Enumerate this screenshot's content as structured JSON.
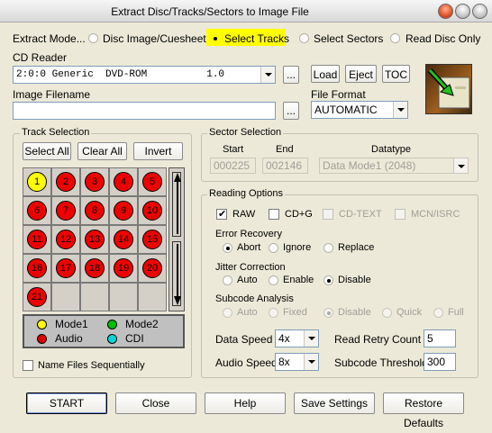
{
  "window": {
    "title": "Extract Disc/Tracks/Sectors to Image File"
  },
  "extract_mode": {
    "label": "Extract Mode...",
    "options": [
      "Disc Image/Cuesheet",
      "Select Tracks",
      "Select Sectors",
      "Read Disc Only"
    ],
    "selected": "Select Tracks"
  },
  "cd_reader": {
    "label": "CD Reader",
    "value": "2:0:0 Generic  DVD-ROM          1.0",
    "browse": "...",
    "load": "Load",
    "eject": "Eject",
    "toc": "TOC"
  },
  "image_filename": {
    "label": "Image Filename",
    "value": "",
    "browse": "..."
  },
  "file_format": {
    "label": "File Format",
    "value": "AUTOMATIC"
  },
  "track_selection": {
    "title": "Track Selection",
    "select_all": "Select All",
    "clear_all": "Clear All",
    "invert": "Invert",
    "tracks": [
      {
        "n": "1",
        "type": "Mode1"
      },
      {
        "n": "2",
        "type": "Audio"
      },
      {
        "n": "3",
        "type": "Audio"
      },
      {
        "n": "4",
        "type": "Audio"
      },
      {
        "n": "5",
        "type": "Audio"
      },
      {
        "n": "6",
        "type": "Audio"
      },
      {
        "n": "7",
        "type": "Audio"
      },
      {
        "n": "8",
        "type": "Audio"
      },
      {
        "n": "9",
        "type": "Audio"
      },
      {
        "n": "10",
        "type": "Audio"
      },
      {
        "n": "11",
        "type": "Audio"
      },
      {
        "n": "12",
        "type": "Audio"
      },
      {
        "n": "13",
        "type": "Audio"
      },
      {
        "n": "14",
        "type": "Audio"
      },
      {
        "n": "15",
        "type": "Audio"
      },
      {
        "n": "16",
        "type": "Audio"
      },
      {
        "n": "17",
        "type": "Audio"
      },
      {
        "n": "18",
        "type": "Audio"
      },
      {
        "n": "19",
        "type": "Audio"
      },
      {
        "n": "20",
        "type": "Audio"
      },
      {
        "n": "21",
        "type": "Audio"
      }
    ],
    "legend": {
      "mode1": "Mode1",
      "mode2": "Mode2",
      "audio": "Audio",
      "cdi": "CDI"
    },
    "name_sequentially": "Name Files Sequentially"
  },
  "sector_selection": {
    "title": "Sector Selection",
    "start_label": "Start",
    "end_label": "End",
    "datatype_label": "Datatype",
    "start_value": "000225",
    "end_value": "002146",
    "datatype_value": "Data  Mode1 (2048)"
  },
  "reading_options": {
    "title": "Reading Options",
    "raw": "RAW",
    "cdg": "CD+G",
    "cdtext": "CD-TEXT",
    "mcn": "MCN/ISRC",
    "error_recovery": {
      "label": "Error Recovery",
      "options": [
        "Abort",
        "Ignore",
        "Replace"
      ],
      "selected": "Abort"
    },
    "jitter": {
      "label": "Jitter Correction",
      "options": [
        "Auto",
        "Enable",
        "Disable"
      ],
      "selected": "Disable"
    },
    "subcode": {
      "label": "Subcode Analysis",
      "options": [
        "Auto",
        "Fixed",
        "Disable",
        "Quick",
        "Full"
      ],
      "selected": "Disable"
    },
    "data_speed": {
      "label": "Data Speed",
      "value": "4x"
    },
    "audio_speed": {
      "label": "Audio Speed",
      "value": "8x"
    },
    "retry": {
      "label": "Read Retry Count",
      "value": "5"
    },
    "threshold": {
      "label": "Subcode Threshold",
      "value": "300"
    }
  },
  "footer": {
    "start": "START",
    "close": "Close",
    "help": "Help",
    "save": "Save Settings",
    "restore": "Restore Defaults"
  },
  "colors": {
    "selected_highlight": "#ffff00",
    "mode1": "#ffff00",
    "mode2": "#00c000",
    "audio": "#e00000",
    "cdi": "#00d8d8"
  }
}
